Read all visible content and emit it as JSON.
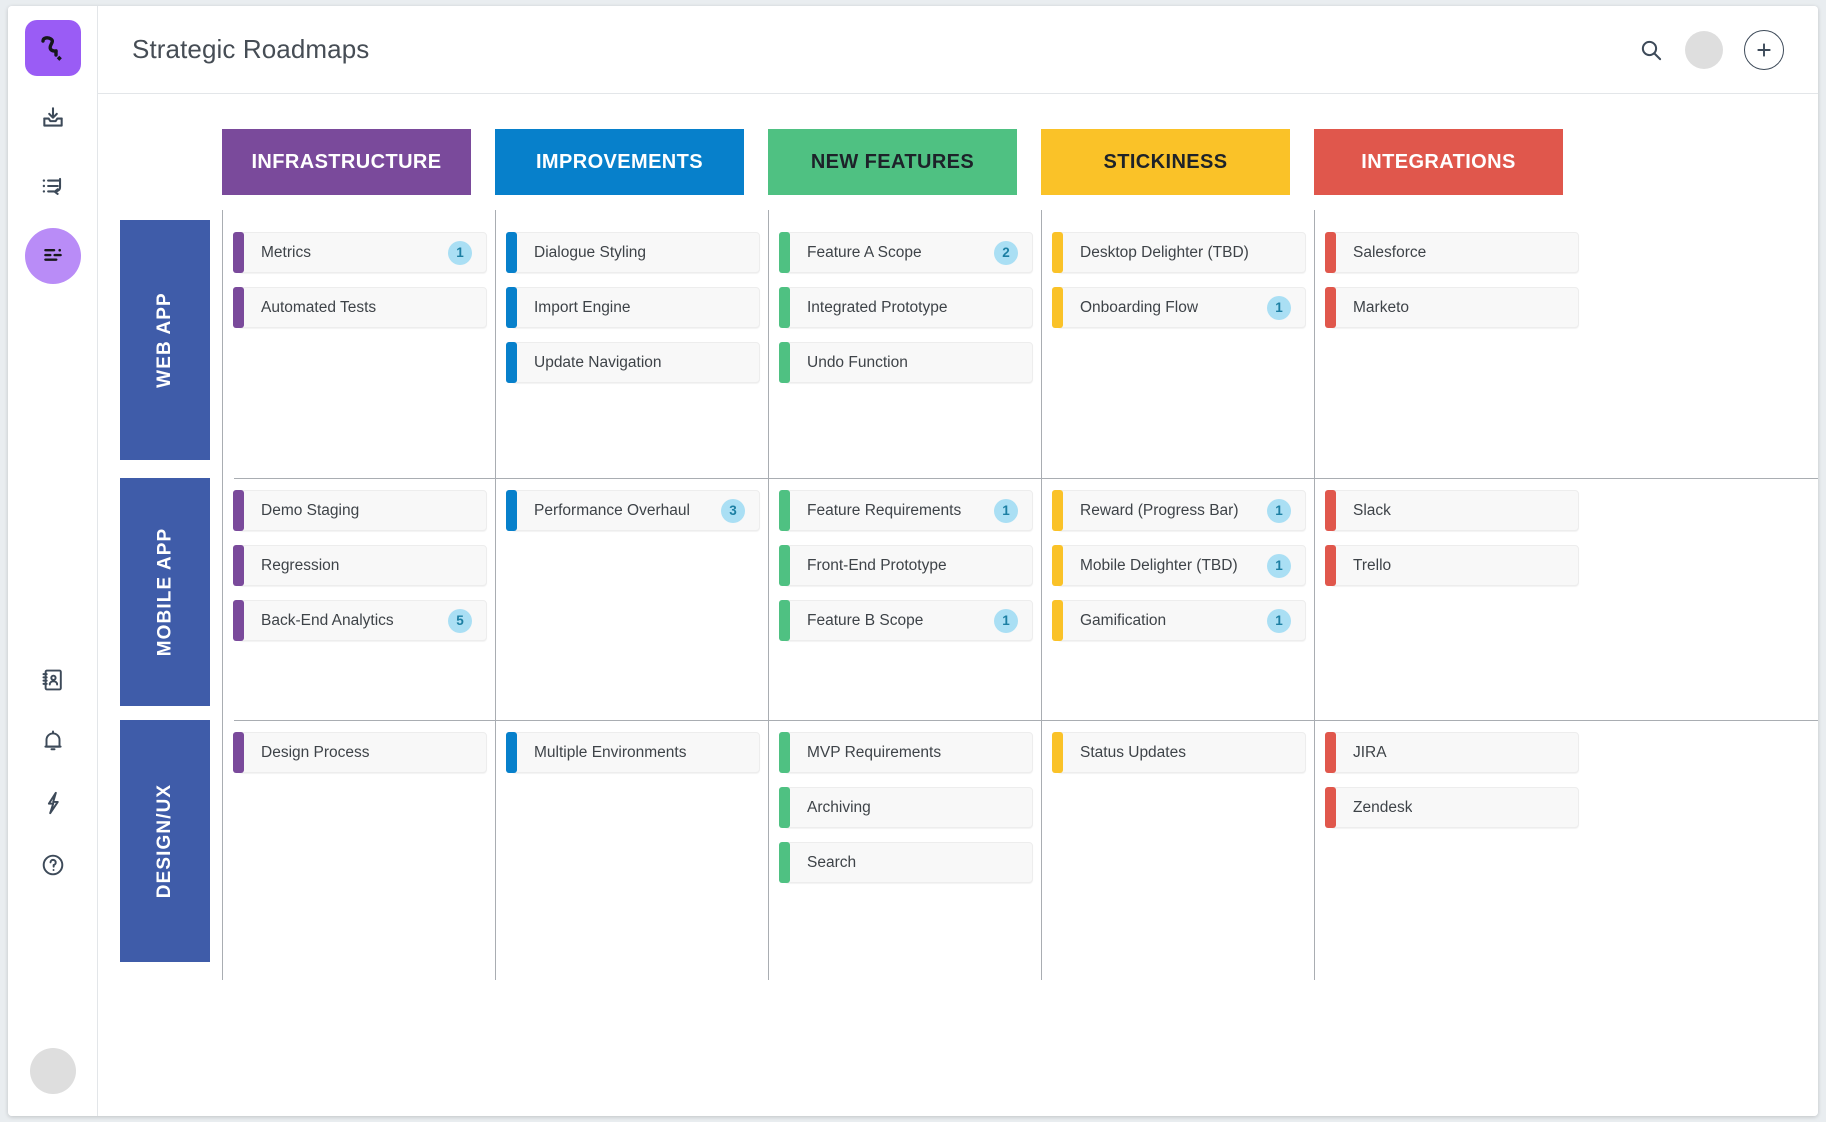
{
  "app": {
    "title": "Strategic Roadmaps"
  },
  "rail": {
    "logo_icon": "productboard-logo-icon",
    "items": [
      {
        "icon": "inbox-download-icon",
        "name": "inbox"
      },
      {
        "icon": "list-loop-icon",
        "name": "features-list"
      },
      {
        "icon": "roadmap-lines-icon",
        "name": "roadmaps",
        "active": true
      },
      {
        "icon": "contact-book-icon",
        "name": "contacts"
      },
      {
        "icon": "bell-icon",
        "name": "notifications"
      },
      {
        "icon": "lightning-icon",
        "name": "integrations"
      },
      {
        "icon": "question-circle-icon",
        "name": "help"
      }
    ],
    "avatar": "user-avatar"
  },
  "topbar": {
    "search_icon": "search-icon",
    "avatar": "user-avatar",
    "add_icon": "plus-icon"
  },
  "colors": {
    "infrastructure": "#7a4a9b",
    "improvements": "#0780cb",
    "new_features": "#4fc182",
    "stickiness": "#fac228",
    "integrations": "#e0574c",
    "row_label": "#3f5ca9",
    "badge_bg": "#aadff4",
    "badge_fg": "#1c7fa3"
  },
  "columns": [
    {
      "label": "INFRASTRUCTURE",
      "color": "#7a4a9b",
      "text_color": "#ffffff"
    },
    {
      "label": "IMPROVEMENTS",
      "color": "#0780cb",
      "text_color": "#ffffff"
    },
    {
      "label": "NEW FEATURES",
      "color": "#4fc182",
      "text_color": "#1d2229"
    },
    {
      "label": "STICKINESS",
      "color": "#fac228",
      "text_color": "#1d2229"
    },
    {
      "label": "INTEGRATIONS",
      "color": "#e0574c",
      "text_color": "#ffffff"
    }
  ],
  "rows": [
    {
      "label": "WEB APP",
      "cells": [
        [
          {
            "label": "Metrics",
            "badge": "1"
          },
          {
            "label": "Automated Tests",
            "badge": null
          }
        ],
        [
          {
            "label": "Dialogue Styling",
            "badge": null
          },
          {
            "label": "Import Engine",
            "badge": null
          },
          {
            "label": "Update Navigation",
            "badge": null
          }
        ],
        [
          {
            "label": "Feature A Scope",
            "badge": "2"
          },
          {
            "label": "Integrated Prototype",
            "badge": null
          },
          {
            "label": "Undo Function",
            "badge": null
          }
        ],
        [
          {
            "label": "Desktop Delighter (TBD)",
            "badge": null
          },
          {
            "label": "Onboarding Flow",
            "badge": "1"
          }
        ],
        [
          {
            "label": "Salesforce",
            "badge": null
          },
          {
            "label": "Marketo",
            "badge": null
          }
        ]
      ]
    },
    {
      "label": "MOBILE APP",
      "cells": [
        [
          {
            "label": "Demo Staging",
            "badge": null
          },
          {
            "label": "Regression",
            "badge": null
          },
          {
            "label": "Back-End Analytics",
            "badge": "5"
          }
        ],
        [
          {
            "label": "Performance Overhaul",
            "badge": "3"
          }
        ],
        [
          {
            "label": "Feature Requirements",
            "badge": "1"
          },
          {
            "label": "Front-End Prototype",
            "badge": null
          },
          {
            "label": "Feature B Scope",
            "badge": "1"
          }
        ],
        [
          {
            "label": "Reward (Progress Bar)",
            "badge": "1"
          },
          {
            "label": "Mobile Delighter (TBD)",
            "badge": "1"
          },
          {
            "label": "Gamification",
            "badge": "1"
          }
        ],
        [
          {
            "label": "Slack",
            "badge": null
          },
          {
            "label": "Trello",
            "badge": null
          }
        ]
      ]
    },
    {
      "label": "DESIGN/UX",
      "cells": [
        [
          {
            "label": "Design Process",
            "badge": null
          }
        ],
        [
          {
            "label": "Multiple Environments",
            "badge": null
          }
        ],
        [
          {
            "label": "MVP Requirements",
            "badge": null
          },
          {
            "label": "Archiving",
            "badge": null
          },
          {
            "label": "Search",
            "badge": null
          }
        ],
        [
          {
            "label": "Status Updates",
            "badge": null
          }
        ],
        [
          {
            "label": "JIRA",
            "badge": null
          },
          {
            "label": "Zendesk",
            "badge": null
          }
        ]
      ]
    }
  ]
}
